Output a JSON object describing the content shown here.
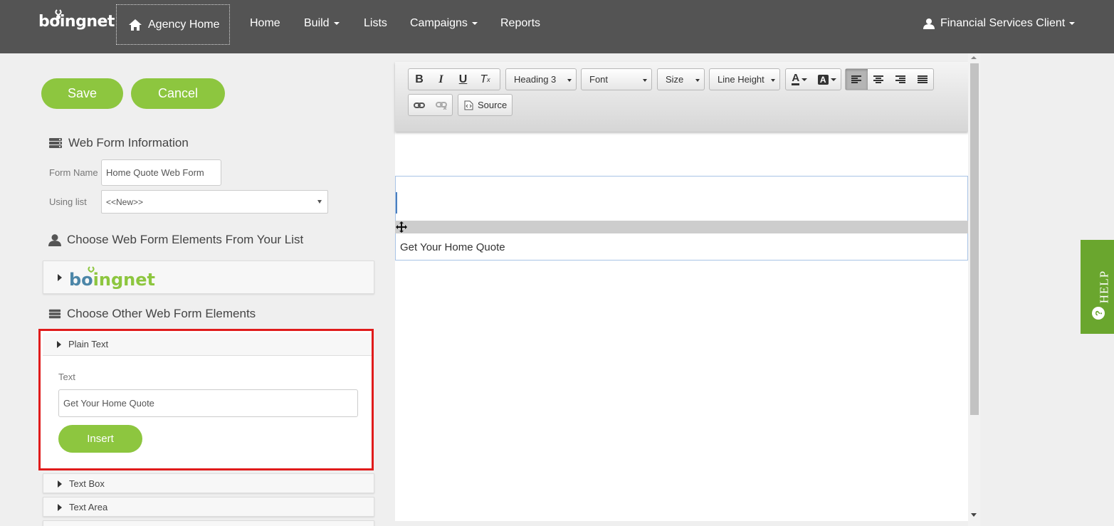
{
  "nav": {
    "logo": "boingnet",
    "agency_home": "Agency Home",
    "items": [
      "Home",
      "Build",
      "Lists",
      "Campaigns",
      "Reports"
    ],
    "user": "Financial Services Client"
  },
  "actions": {
    "save": "Save",
    "cancel": "Cancel"
  },
  "info": {
    "heading": "Web Form Information",
    "form_name_label": "Form Name",
    "form_name_value": "Home Quote Web Form",
    "using_list_label": "Using list",
    "using_list_value": "<<New>>"
  },
  "list_elements": {
    "heading": "Choose Web Form Elements From Your List",
    "logo": "boingnet"
  },
  "other_elements": {
    "heading": "Choose Other Web Form Elements",
    "plain_text": {
      "title": "Plain Text",
      "text_label": "Text",
      "text_value": "Get Your Home Quote",
      "insert": "Insert"
    },
    "text_box": "Text Box",
    "text_area": "Text Area"
  },
  "toolbar": {
    "format": "Heading 3",
    "font": "Font",
    "size": "Size",
    "line_height": "Line Height",
    "source": "Source"
  },
  "editor": {
    "content_text": "Get Your Home Quote"
  },
  "help": "HELP",
  "colors": {
    "accent": "#8dc63f",
    "nav_bg": "#545454",
    "highlight": "#e01b1b",
    "help_bg": "#6aa62e"
  }
}
